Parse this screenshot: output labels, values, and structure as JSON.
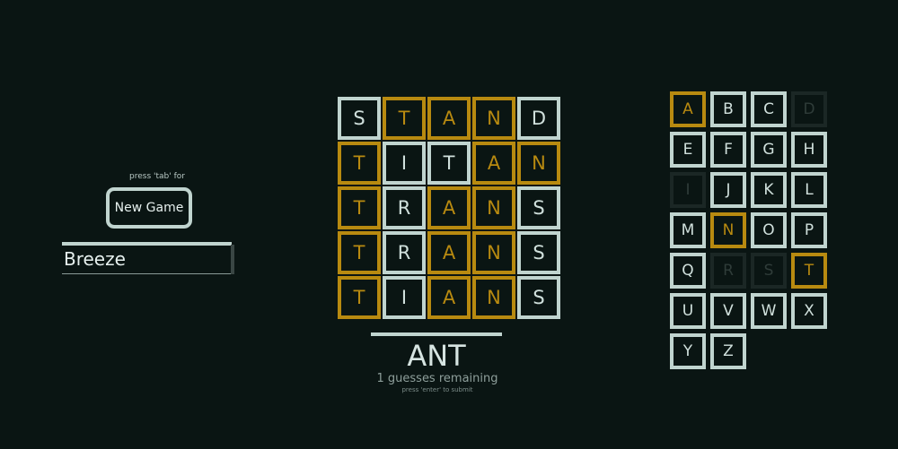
{
  "sidebar": {
    "hint": "press 'tab' for",
    "new_game_label": "New Game",
    "name_value": "Breeze"
  },
  "board": {
    "rows": [
      {
        "letters": [
          "S",
          "T",
          "A",
          "N",
          "D"
        ],
        "states": [
          "grey",
          "gold",
          "gold",
          "gold",
          "grey"
        ]
      },
      {
        "letters": [
          "T",
          "I",
          "T",
          "A",
          "N"
        ],
        "states": [
          "gold",
          "grey",
          "grey",
          "gold",
          "gold"
        ]
      },
      {
        "letters": [
          "T",
          "R",
          "A",
          "N",
          "S"
        ],
        "states": [
          "gold",
          "grey",
          "gold",
          "gold",
          "grey"
        ]
      },
      {
        "letters": [
          "T",
          "R",
          "A",
          "N",
          "S"
        ],
        "states": [
          "gold",
          "grey",
          "gold",
          "gold",
          "grey"
        ]
      },
      {
        "letters": [
          "T",
          "I",
          "A",
          "N",
          "S"
        ],
        "states": [
          "gold",
          "grey",
          "gold",
          "gold",
          "grey"
        ]
      }
    ]
  },
  "guess": {
    "current": "ANT",
    "remaining": "1 guesses remaining",
    "submit_hint": "press 'enter' to submit"
  },
  "keyboard": {
    "keys": [
      {
        "l": "A",
        "s": "gold"
      },
      {
        "l": "B",
        "s": "avail"
      },
      {
        "l": "C",
        "s": "avail"
      },
      {
        "l": "D",
        "s": "used"
      },
      {
        "l": "E",
        "s": "avail"
      },
      {
        "l": "F",
        "s": "avail"
      },
      {
        "l": "G",
        "s": "avail"
      },
      {
        "l": "H",
        "s": "avail"
      },
      {
        "l": "I",
        "s": "used"
      },
      {
        "l": "J",
        "s": "avail"
      },
      {
        "l": "K",
        "s": "avail"
      },
      {
        "l": "L",
        "s": "avail"
      },
      {
        "l": "M",
        "s": "avail"
      },
      {
        "l": "N",
        "s": "gold"
      },
      {
        "l": "O",
        "s": "avail"
      },
      {
        "l": "P",
        "s": "avail"
      },
      {
        "l": "Q",
        "s": "avail"
      },
      {
        "l": "R",
        "s": "used"
      },
      {
        "l": "S",
        "s": "used"
      },
      {
        "l": "T",
        "s": "gold"
      },
      {
        "l": "U",
        "s": "avail"
      },
      {
        "l": "V",
        "s": "avail"
      },
      {
        "l": "W",
        "s": "avail"
      },
      {
        "l": "X",
        "s": "avail"
      },
      {
        "l": "Y",
        "s": "avail"
      },
      {
        "l": "Z",
        "s": "avail"
      }
    ]
  },
  "colors": {
    "background": "#0a1513",
    "tile_border": "#c0d4cf",
    "present": "#b88a10",
    "used": "#1b2725"
  }
}
